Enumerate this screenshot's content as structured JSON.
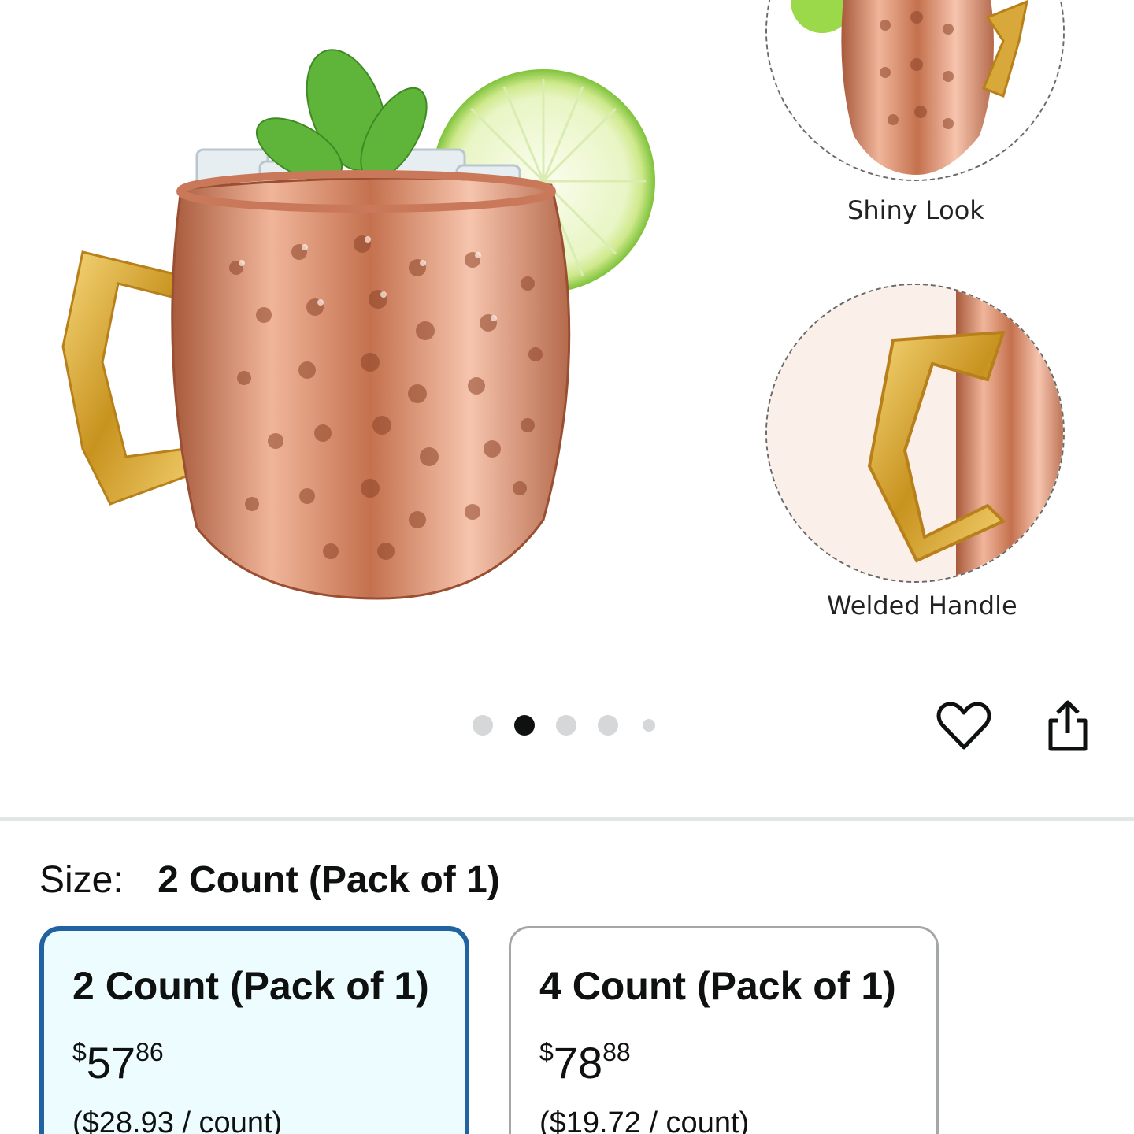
{
  "gallery": {
    "callouts": [
      {
        "label": "Shiny Look"
      },
      {
        "label": "Welded Handle"
      }
    ],
    "dots": {
      "count": 5,
      "active_index": 1
    },
    "icons": {
      "favorite": "heart-icon",
      "share": "share-icon"
    }
  },
  "size": {
    "label": "Size:",
    "selected_value": "2 Count (Pack of 1)"
  },
  "options": [
    {
      "title": "2 Count (Pack of 1)",
      "currency": "$",
      "whole": "57",
      "fraction": "86",
      "unit_price": "($28.93 / count)",
      "selected": true
    },
    {
      "title": "4 Count (Pack of 1)",
      "currency": "$",
      "whole": "78",
      "fraction": "88",
      "unit_price": "($19.72 / count)",
      "selected": false
    }
  ],
  "colors": {
    "selected_border": "#2162a1",
    "selected_bg": "#edfdff",
    "copper": "#d98e6d",
    "brass": "#d8a93a",
    "lime": "#9bd84a",
    "mint": "#5fb53a"
  }
}
